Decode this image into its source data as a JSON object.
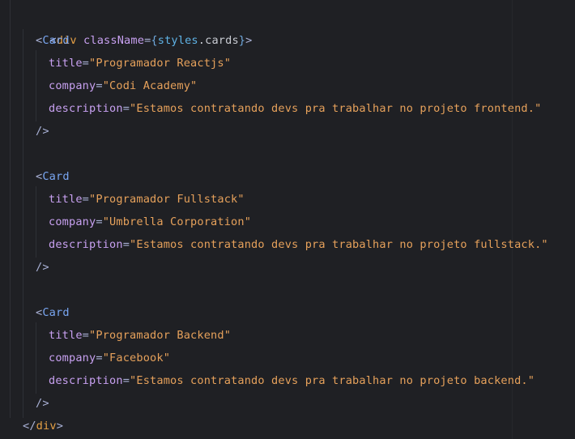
{
  "colors": {
    "background": "#1f2024",
    "tag": "#e5a046",
    "attribute": "#c7a0f0",
    "string": "#e6a15b",
    "component": "#79a6f2",
    "punctuation": "#a9b1d6"
  },
  "code": {
    "open_div": {
      "lt": "<",
      "tag": "div",
      "attr": "className",
      "eq": "=",
      "lbrace": "{",
      "obj": "styles",
      "dot": ".",
      "prop": "cards",
      "rbrace": "}",
      "gt": ">"
    },
    "cards": [
      {
        "lt": "<",
        "component": "Card",
        "props": [
          {
            "name": "title",
            "eq": "=",
            "value": "\"Programador Reactjs\""
          },
          {
            "name": "company",
            "eq": "=",
            "value": "\"Codi Academy\""
          },
          {
            "name": "description",
            "eq": "=",
            "value": "\"Estamos contratando devs pra trabalhar no projeto frontend.\""
          }
        ],
        "close": "/>"
      },
      {
        "lt": "<",
        "component": "Card",
        "props": [
          {
            "name": "title",
            "eq": "=",
            "value": "\"Programador Fullstack\""
          },
          {
            "name": "company",
            "eq": "=",
            "value": "\"Umbrella Corporation\""
          },
          {
            "name": "description",
            "eq": "=",
            "value": "\"Estamos contratando devs pra trabalhar no projeto fullstack.\""
          }
        ],
        "close": "/>"
      },
      {
        "lt": "<",
        "component": "Card",
        "props": [
          {
            "name": "title",
            "eq": "=",
            "value": "\"Programador Backend\""
          },
          {
            "name": "company",
            "eq": "=",
            "value": "\"Facebook\""
          },
          {
            "name": "description",
            "eq": "=",
            "value": "\"Estamos contratando devs pra trabalhar no projeto backend.\""
          }
        ],
        "close": "/>"
      }
    ],
    "close_div": {
      "lt": "</",
      "tag": "div",
      "gt": ">"
    }
  }
}
